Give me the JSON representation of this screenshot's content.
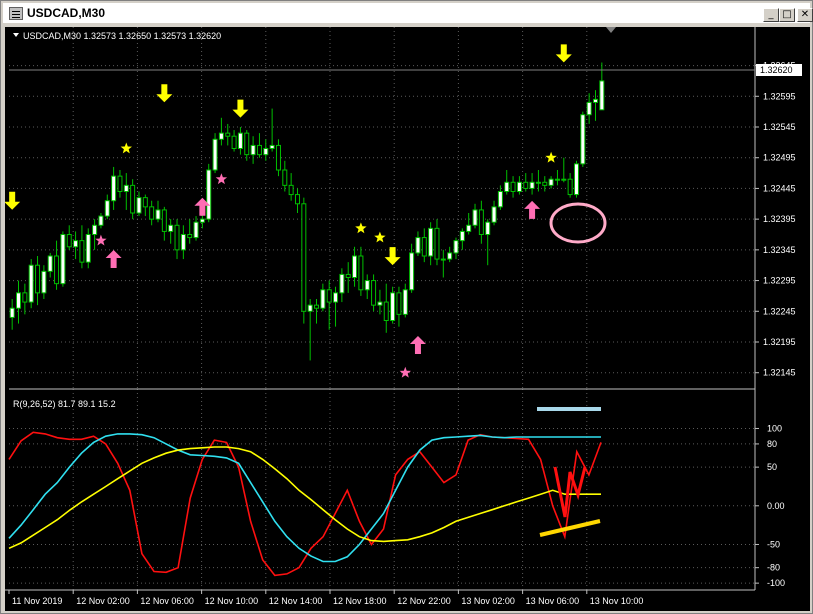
{
  "window": {
    "title": "USDCAD,M30",
    "icon": "chart-window-icon",
    "buttons": {
      "minimize": "_",
      "maximize": "□",
      "close": "✕"
    }
  },
  "main_pane": {
    "header": "USDCAD,M30  1.32573 1.32650 1.32573 1.32620",
    "symbol": "USDCAD",
    "timeframe": "M30",
    "ohlc": {
      "open": 1.32573,
      "high": 1.3265,
      "low": 1.32573,
      "close": 1.3262
    },
    "current_price_label": "1.32620",
    "price_ticks": [
      "1.32645",
      "1.32595",
      "1.32545",
      "1.32495",
      "1.32445",
      "1.32395",
      "1.32345",
      "1.32295",
      "1.32245",
      "1.32195",
      "1.32145"
    ]
  },
  "indicator_pane": {
    "header": "R(9,26,52) 81.7 89.1 15.2",
    "values": [
      81.7,
      89.1,
      15.2
    ],
    "ticks": [
      "100",
      "80",
      "50",
      "0.00",
      "-50",
      "-80",
      "-100"
    ]
  },
  "time_axis": [
    "11 Nov 2019",
    "12 Nov 02:00",
    "12 Nov 06:00",
    "12 Nov 10:00",
    "12 Nov 14:00",
    "12 Nov 18:00",
    "12 Nov 22:00",
    "13 Nov 02:00",
    "13 Nov 06:00",
    "13 Nov 10:00"
  ],
  "colors": {
    "background": "#000000",
    "bull_candle": "#ffffff",
    "bear_candle": "#000000",
    "wick": "#00c000",
    "red_line": "#ff1010",
    "cyan_line": "#30e0f0",
    "yellow_line": "#ffff00",
    "sell_arrow": "#ffff00",
    "buy_arrow": "#ff6eb4",
    "star_yellow": "#ffff00",
    "star_pink": "#ff6eb4"
  },
  "chart_data": [
    {
      "type": "candlestick",
      "ylim": [
        1.32125,
        1.32685
      ],
      "candles": [
        [
          1.32235,
          1.32265,
          1.32215,
          1.3225
        ],
        [
          1.3225,
          1.32295,
          1.32225,
          1.32275
        ],
        [
          1.32275,
          1.3229,
          1.3224,
          1.3226
        ],
        [
          1.3226,
          1.3233,
          1.3225,
          1.3232
        ],
        [
          1.3232,
          1.32335,
          1.32255,
          1.32275
        ],
        [
          1.32275,
          1.3232,
          1.32265,
          1.3231
        ],
        [
          1.3231,
          1.3234,
          1.323,
          1.32335
        ],
        [
          1.32335,
          1.3236,
          1.3228,
          1.3229
        ],
        [
          1.3229,
          1.32375,
          1.32285,
          1.3237
        ],
        [
          1.3237,
          1.32385,
          1.32345,
          1.3235
        ],
        [
          1.3235,
          1.32375,
          1.3233,
          1.3236
        ],
        [
          1.3236,
          1.32385,
          1.32315,
          1.32325
        ],
        [
          1.32325,
          1.3238,
          1.32315,
          1.3237
        ],
        [
          1.3237,
          1.32395,
          1.32345,
          1.32385
        ],
        [
          1.32385,
          1.32405,
          1.3238,
          1.324
        ],
        [
          1.324,
          1.32435,
          1.32395,
          1.32425
        ],
        [
          1.32425,
          1.3248,
          1.3241,
          1.32465
        ],
        [
          1.32465,
          1.32475,
          1.3243,
          1.3244
        ],
        [
          1.3244,
          1.3247,
          1.3241,
          1.3245
        ],
        [
          1.3245,
          1.3246,
          1.32395,
          1.32405
        ],
        [
          1.32405,
          1.3244,
          1.324,
          1.3243
        ],
        [
          1.3243,
          1.32435,
          1.324,
          1.32415
        ],
        [
          1.32415,
          1.32425,
          1.32385,
          1.32395
        ],
        [
          1.32395,
          1.32425,
          1.3239,
          1.3241
        ],
        [
          1.3241,
          1.32415,
          1.3236,
          1.32375
        ],
        [
          1.32375,
          1.32395,
          1.32355,
          1.32385
        ],
        [
          1.32385,
          1.32395,
          1.3233,
          1.32345
        ],
        [
          1.32345,
          1.32385,
          1.3233,
          1.3237
        ],
        [
          1.3237,
          1.32395,
          1.32355,
          1.32365
        ],
        [
          1.32365,
          1.324,
          1.3236,
          1.3239
        ],
        [
          1.3239,
          1.32405,
          1.3238,
          1.32395
        ],
        [
          1.32395,
          1.32485,
          1.3239,
          1.32475
        ],
        [
          1.32475,
          1.32535,
          1.3247,
          1.32525
        ],
        [
          1.32525,
          1.3256,
          1.32515,
          1.32535
        ],
        [
          1.32535,
          1.3255,
          1.32515,
          1.3253
        ],
        [
          1.3253,
          1.3254,
          1.32505,
          1.3251
        ],
        [
          1.3251,
          1.32545,
          1.325,
          1.32535
        ],
        [
          1.32535,
          1.3254,
          1.3249,
          1.325
        ],
        [
          1.325,
          1.3253,
          1.32485,
          1.32515
        ],
        [
          1.32515,
          1.32535,
          1.32495,
          1.325
        ],
        [
          1.325,
          1.32525,
          1.3249,
          1.3251
        ],
        [
          1.3251,
          1.32575,
          1.32505,
          1.32515
        ],
        [
          1.32515,
          1.32525,
          1.32465,
          1.32475
        ],
        [
          1.32475,
          1.3249,
          1.3244,
          1.3245
        ],
        [
          1.3245,
          1.3247,
          1.32425,
          1.32435
        ],
        [
          1.32435,
          1.32445,
          1.32405,
          1.3242
        ],
        [
          1.3242,
          1.3243,
          1.32225,
          1.32245
        ],
        [
          1.32245,
          1.32265,
          1.32165,
          1.32255
        ],
        [
          1.32255,
          1.32265,
          1.32225,
          1.3225
        ],
        [
          1.3225,
          1.3229,
          1.32245,
          1.3228
        ],
        [
          1.3228,
          1.32295,
          1.32215,
          1.3226
        ],
        [
          1.3226,
          1.32285,
          1.3222,
          1.32275
        ],
        [
          1.32275,
          1.32315,
          1.3226,
          1.32305
        ],
        [
          1.32305,
          1.32325,
          1.32275,
          1.323
        ],
        [
          1.323,
          1.3235,
          1.32285,
          1.32335
        ],
        [
          1.32335,
          1.3235,
          1.3227,
          1.3228
        ],
        [
          1.3228,
          1.32305,
          1.32265,
          1.32295
        ],
        [
          1.32295,
          1.32305,
          1.32245,
          1.32255
        ],
        [
          1.32255,
          1.3228,
          1.3224,
          1.3226
        ],
        [
          1.3226,
          1.3229,
          1.3221,
          1.3223
        ],
        [
          1.3223,
          1.32285,
          1.32225,
          1.32275
        ],
        [
          1.32275,
          1.32285,
          1.3222,
          1.3224
        ],
        [
          1.3224,
          1.3229,
          1.32235,
          1.3228
        ],
        [
          1.3228,
          1.32355,
          1.32275,
          1.3234
        ],
        [
          1.3234,
          1.32375,
          1.32335,
          1.32365
        ],
        [
          1.32365,
          1.3238,
          1.32325,
          1.32335
        ],
        [
          1.32335,
          1.3239,
          1.3232,
          1.3238
        ],
        [
          1.3238,
          1.32395,
          1.3232,
          1.3233
        ],
        [
          1.3233,
          1.32345,
          1.323,
          1.3233
        ],
        [
          1.3233,
          1.3235,
          1.32325,
          1.3234
        ],
        [
          1.3234,
          1.32365,
          1.3233,
          1.3236
        ],
        [
          1.3236,
          1.3238,
          1.32345,
          1.32375
        ],
        [
          1.32375,
          1.32405,
          1.3237,
          1.32385
        ],
        [
          1.32385,
          1.3242,
          1.3238,
          1.3241
        ],
        [
          1.3241,
          1.32425,
          1.32355,
          1.3237
        ],
        [
          1.3237,
          1.32395,
          1.3232,
          1.3239
        ],
        [
          1.3239,
          1.32425,
          1.32385,
          1.32415
        ],
        [
          1.32415,
          1.3245,
          1.3241,
          1.3244
        ],
        [
          1.3244,
          1.32475,
          1.32435,
          1.32455
        ],
        [
          1.32455,
          1.32465,
          1.3243,
          1.3244
        ],
        [
          1.3244,
          1.32465,
          1.32435,
          1.32455
        ],
        [
          1.32455,
          1.3247,
          1.3244,
          1.32445
        ],
        [
          1.32445,
          1.3247,
          1.32435,
          1.32455
        ],
        [
          1.32455,
          1.32475,
          1.3244,
          1.32455
        ],
        [
          1.32455,
          1.32465,
          1.3244,
          1.3245
        ],
        [
          1.3245,
          1.32465,
          1.32445,
          1.3246
        ],
        [
          1.3246,
          1.32475,
          1.3245,
          1.3246
        ],
        [
          1.3246,
          1.32495,
          1.32455,
          1.3246
        ],
        [
          1.3246,
          1.3247,
          1.3243,
          1.32435
        ],
        [
          1.32435,
          1.3249,
          1.3243,
          1.32485
        ],
        [
          1.32485,
          1.3257,
          1.3248,
          1.32565
        ],
        [
          1.32565,
          1.326,
          1.3255,
          1.32585
        ],
        [
          1.32585,
          1.32605,
          1.32555,
          1.3259
        ],
        [
          1.32573,
          1.3265,
          1.32573,
          1.3262
        ]
      ],
      "sell_arrows": [
        1.32595,
        1.3257,
        1.3242,
        1.3233,
        1.3266
      ],
      "buy_arrows": [
        1.32335,
        1.3242,
        1.32195,
        1.32415
      ],
      "yellow_stars": [
        1.3251,
        1.3238,
        1.32365,
        1.32495
      ],
      "pink_stars": [
        1.3236,
        1.3246,
        1.32145
      ]
    },
    {
      "type": "line",
      "ylim": [
        -105,
        120
      ],
      "series": [
        {
          "color": "#ff1010",
          "values": [
            60,
            84,
            95,
            93,
            88,
            86,
            86,
            90,
            80,
            55,
            20,
            -62,
            -85,
            -86,
            -80,
            10,
            60,
            85,
            82,
            50,
            -20,
            -70,
            -90,
            -88,
            -80,
            -55,
            -40,
            -10,
            20,
            -20,
            -50,
            -30,
            40,
            60,
            70,
            50,
            30,
            40,
            85,
            92,
            89,
            88,
            87,
            86,
            60,
            0,
            -40,
            70,
            40,
            82
          ]
        },
        {
          "color": "#30e0f0",
          "values": [
            -42,
            -25,
            -5,
            15,
            30,
            50,
            68,
            82,
            90,
            93,
            93,
            92,
            88,
            80,
            72,
            66,
            65,
            64,
            62,
            55,
            30,
            5,
            -20,
            -40,
            -55,
            -65,
            -72,
            -72,
            -66,
            -50,
            -30,
            -10,
            20,
            50,
            72,
            85,
            88,
            89,
            90,
            91,
            89,
            88,
            89,
            89,
            89,
            89,
            89,
            89,
            89,
            89
          ]
        },
        {
          "color": "#ffff00",
          "values": [
            -55,
            -48,
            -38,
            -28,
            -18,
            -6,
            5,
            15,
            25,
            35,
            45,
            55,
            62,
            68,
            72,
            74,
            75,
            76,
            76,
            74,
            70,
            60,
            48,
            35,
            20,
            8,
            -5,
            -18,
            -30,
            -40,
            -45,
            -46,
            -45,
            -44,
            -40,
            -35,
            -28,
            -20,
            -15,
            -10,
            -5,
            0,
            5,
            10,
            15,
            20,
            15,
            15,
            15,
            15
          ]
        }
      ]
    }
  ]
}
